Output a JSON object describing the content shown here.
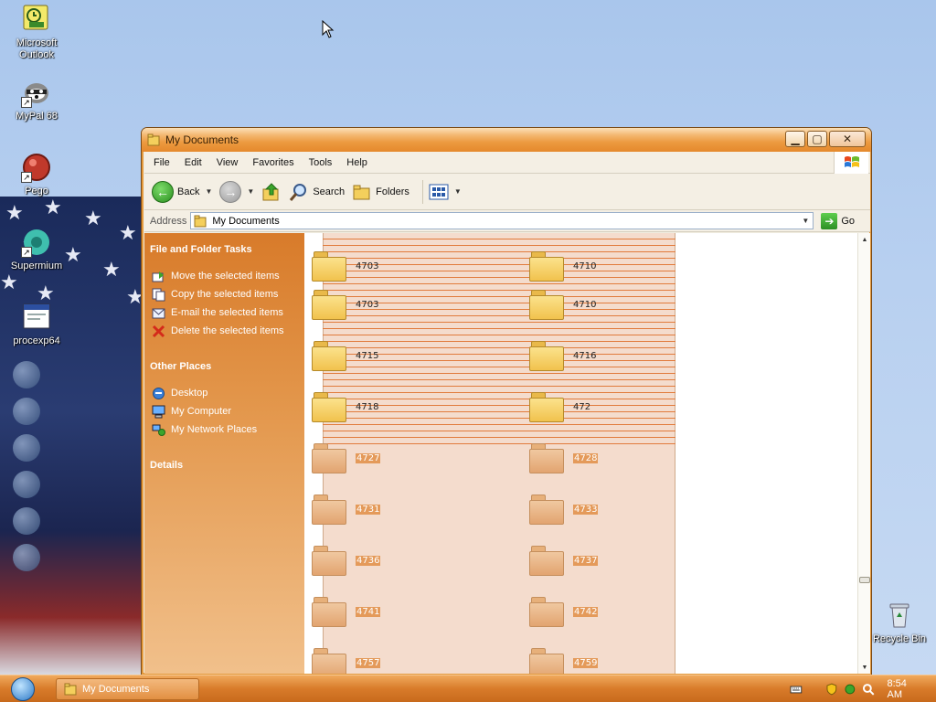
{
  "desktop": {
    "icons": [
      {
        "label": "Microsoft Outlook"
      },
      {
        "label": "MyPal 68"
      },
      {
        "label": "Pego"
      },
      {
        "label": "Supermium"
      },
      {
        "label": "procexp64"
      },
      {
        "label": "Recycle Bin"
      }
    ]
  },
  "window": {
    "title": "My Documents",
    "menu": [
      "File",
      "Edit",
      "View",
      "Favorites",
      "Tools",
      "Help"
    ],
    "toolbar": {
      "back": "Back",
      "search": "Search",
      "folders": "Folders"
    },
    "address": {
      "label": "Address",
      "value": "My Documents",
      "go": "Go"
    },
    "task_pane": {
      "file_tasks": {
        "title": "File and Folder Tasks",
        "items": [
          "Move the selected items",
          "Copy the selected items",
          "E-mail the selected items",
          "Delete the selected items"
        ]
      },
      "other_places": {
        "title": "Other Places",
        "items": [
          "Desktop",
          "My Computer",
          "My Network Places"
        ]
      },
      "details": {
        "title": "Details"
      }
    },
    "files": [
      {
        "name": "4703",
        "state": "selected-partial"
      },
      {
        "name": "4710",
        "state": "selected-partial"
      },
      {
        "name": "4703",
        "state": "selected"
      },
      {
        "name": "4710",
        "state": "selected"
      },
      {
        "name": "4715",
        "state": "selected"
      },
      {
        "name": "4716",
        "state": "selected"
      },
      {
        "name": "4718",
        "state": "selected"
      },
      {
        "name": "472",
        "state": "selected"
      },
      {
        "name": "4727",
        "state": "highlighted"
      },
      {
        "name": "4728",
        "state": "highlighted"
      },
      {
        "name": "4731",
        "state": "highlighted"
      },
      {
        "name": "4733",
        "state": "highlighted"
      },
      {
        "name": "4736",
        "state": "highlighted"
      },
      {
        "name": "4737",
        "state": "highlighted"
      },
      {
        "name": "4741",
        "state": "highlighted"
      },
      {
        "name": "4742",
        "state": "highlighted"
      },
      {
        "name": "4757",
        "state": "highlighted"
      },
      {
        "name": "4759",
        "state": "highlighted"
      }
    ]
  },
  "taskbar": {
    "task_label": "My Documents",
    "clock": "8:54 AM"
  },
  "colors": {
    "title_orange": "#e5892c",
    "taskpane_orange": "#d87b2a",
    "selection_fill": "#f4dccd",
    "name_highlight": "#e49a5a"
  }
}
